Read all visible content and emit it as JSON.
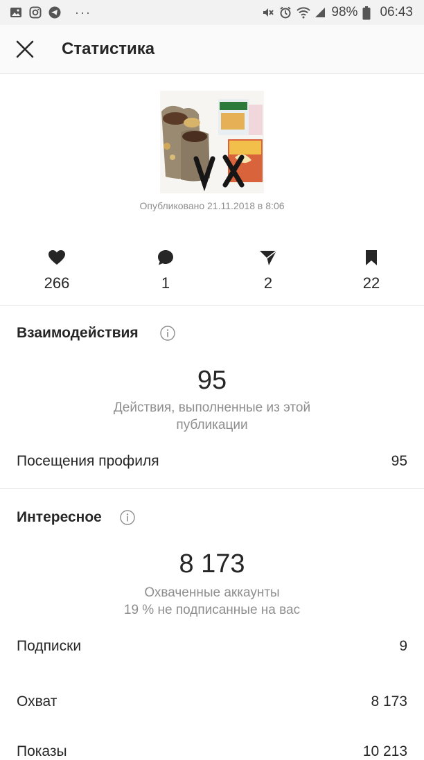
{
  "status_bar": {
    "battery": "98%",
    "time": "06:43",
    "dots": "···"
  },
  "header": {
    "title": "Статистика"
  },
  "post": {
    "published": "Опубликовано 21.11.2018 в 8:06",
    "image_text": "VX"
  },
  "counters": [
    {
      "icon": "heart-icon",
      "value": "266"
    },
    {
      "icon": "comment-icon",
      "value": "1"
    },
    {
      "icon": "send-icon",
      "value": "2"
    },
    {
      "icon": "bookmark-icon",
      "value": "22"
    }
  ],
  "interactions": {
    "title": "Взаимодействия",
    "total": "95",
    "caption_line1": "Действия, выполненные из этой",
    "caption_line2": "публикации",
    "rows": [
      {
        "label": "Посещения профиля",
        "value": "95"
      }
    ]
  },
  "discovery": {
    "title": "Интересное",
    "total": "8 173",
    "caption_line1": "Охваченные аккаунты",
    "caption_line2": "19 % не подписанные на вас",
    "rows": [
      {
        "label": "Подписки",
        "value": "9"
      },
      {
        "label": "Охват",
        "value": "8 173"
      },
      {
        "label": "Показы",
        "value": "10 213"
      }
    ]
  }
}
